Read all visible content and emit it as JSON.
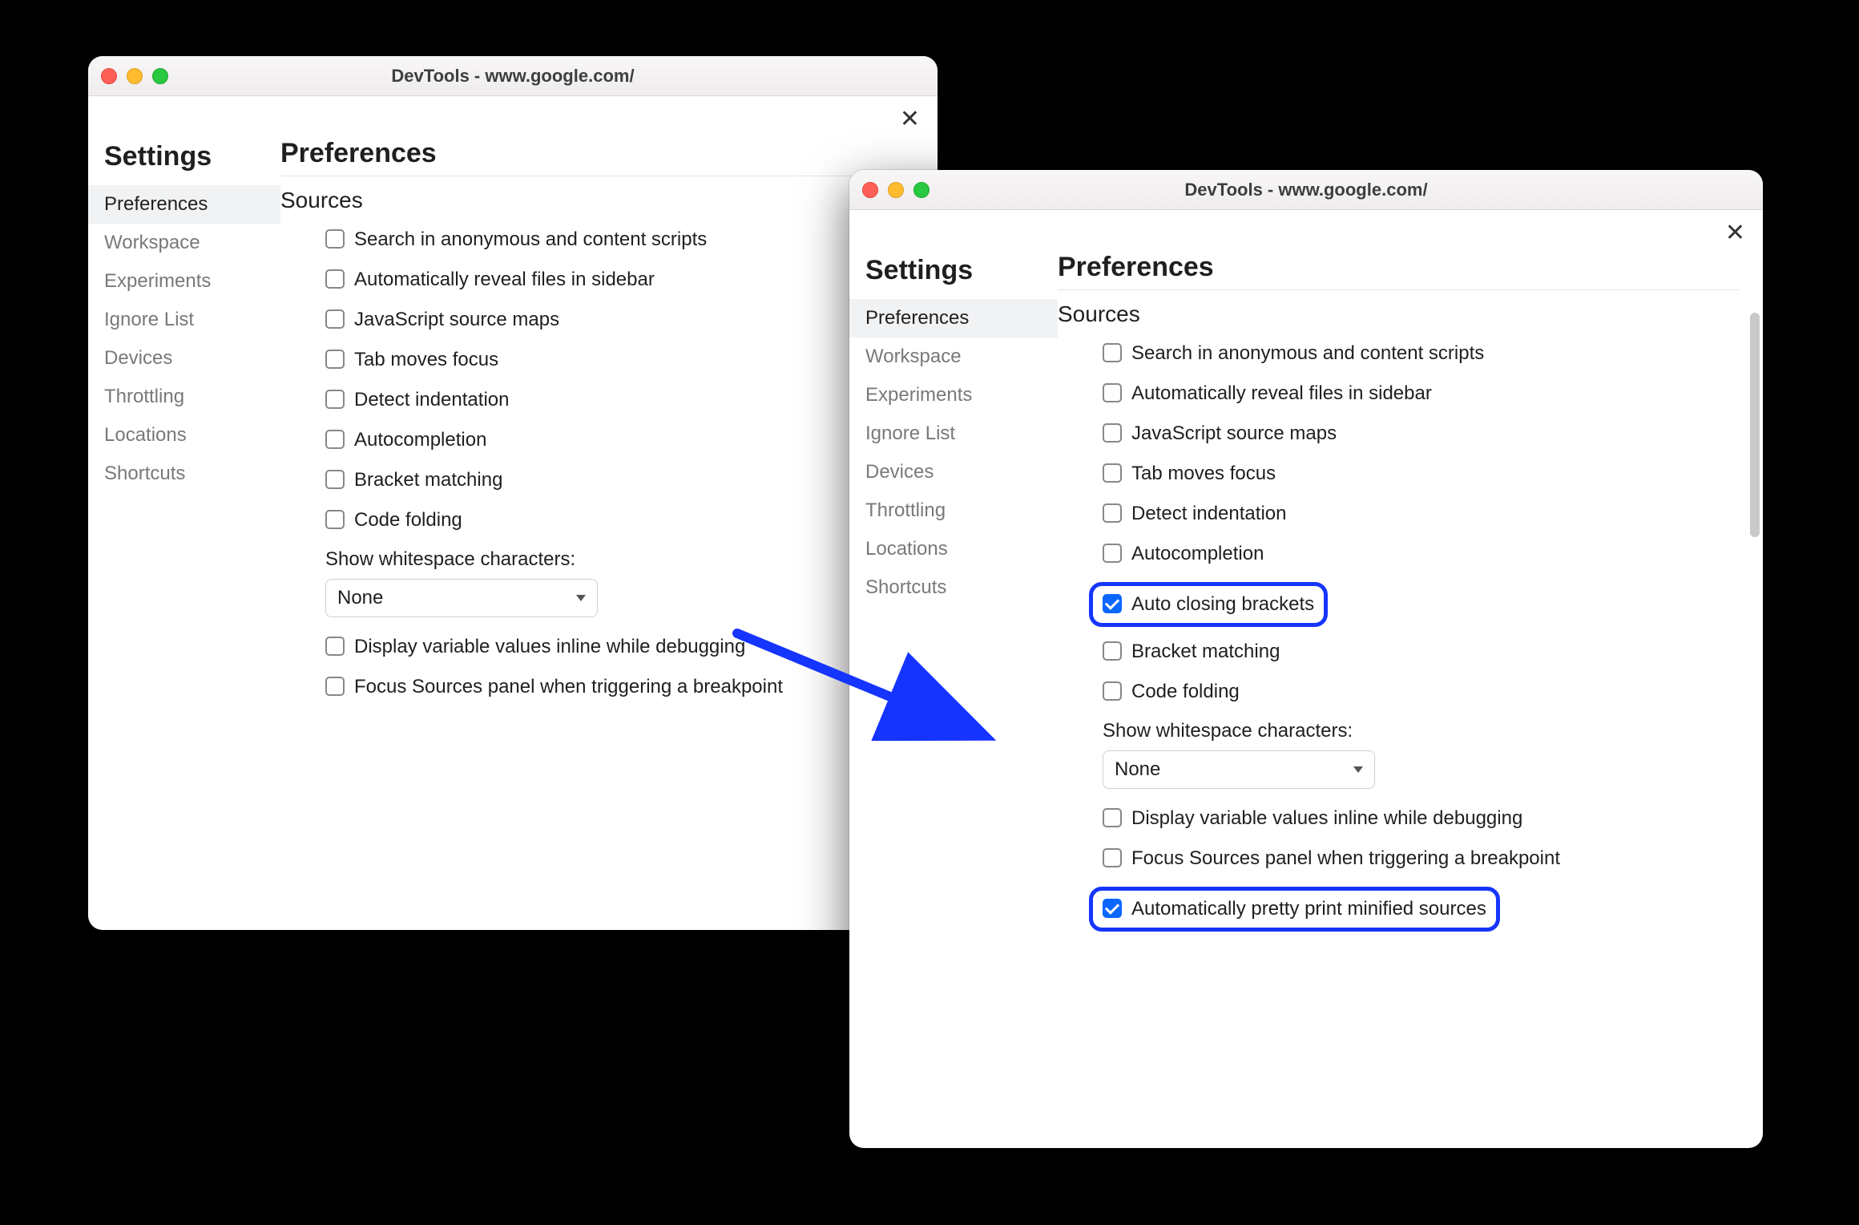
{
  "window_title": "DevTools - www.google.com/",
  "settings_heading": "Settings",
  "main_heading": "Preferences",
  "section_title": "Sources",
  "nav": [
    {
      "label": "Preferences",
      "active": true
    },
    {
      "label": "Workspace",
      "active": false
    },
    {
      "label": "Experiments",
      "active": false
    },
    {
      "label": "Ignore List",
      "active": false
    },
    {
      "label": "Devices",
      "active": false
    },
    {
      "label": "Throttling",
      "active": false
    },
    {
      "label": "Locations",
      "active": false
    },
    {
      "label": "Shortcuts",
      "active": false
    }
  ],
  "whitespace_label": "Show whitespace characters:",
  "whitespace_value": "None",
  "left_options": [
    {
      "label": "Search in anonymous and content scripts",
      "checked": false
    },
    {
      "label": "Automatically reveal files in sidebar",
      "checked": false
    },
    {
      "label": "JavaScript source maps",
      "checked": false
    },
    {
      "label": "Tab moves focus",
      "checked": false
    },
    {
      "label": "Detect indentation",
      "checked": false
    },
    {
      "label": "Autocompletion",
      "checked": false
    },
    {
      "label": "Bracket matching",
      "checked": false
    },
    {
      "label": "Code folding",
      "checked": false
    }
  ],
  "left_tail": [
    {
      "label": "Display variable values inline while debugging",
      "checked": false
    },
    {
      "label": "Focus Sources panel when triggering a breakpoint",
      "checked": false
    }
  ],
  "right_options": [
    {
      "label": "Search in anonymous and content scripts",
      "checked": false,
      "hl": false
    },
    {
      "label": "Automatically reveal files in sidebar",
      "checked": false,
      "hl": false
    },
    {
      "label": "JavaScript source maps",
      "checked": false,
      "hl": false
    },
    {
      "label": "Tab moves focus",
      "checked": false,
      "hl": false
    },
    {
      "label": "Detect indentation",
      "checked": false,
      "hl": false
    },
    {
      "label": "Autocompletion",
      "checked": false,
      "hl": false
    },
    {
      "label": "Auto closing brackets",
      "checked": true,
      "hl": true
    },
    {
      "label": "Bracket matching",
      "checked": false,
      "hl": false
    },
    {
      "label": "Code folding",
      "checked": false,
      "hl": false
    }
  ],
  "right_tail": [
    {
      "label": "Display variable values inline while debugging",
      "checked": false,
      "hl": false
    },
    {
      "label": "Focus Sources panel when triggering a breakpoint",
      "checked": false,
      "hl": false
    },
    {
      "label": "Automatically pretty print minified sources",
      "checked": true,
      "hl": true
    }
  ],
  "colors": {
    "highlight": "#1535ff",
    "accent": "#0a67ff"
  }
}
